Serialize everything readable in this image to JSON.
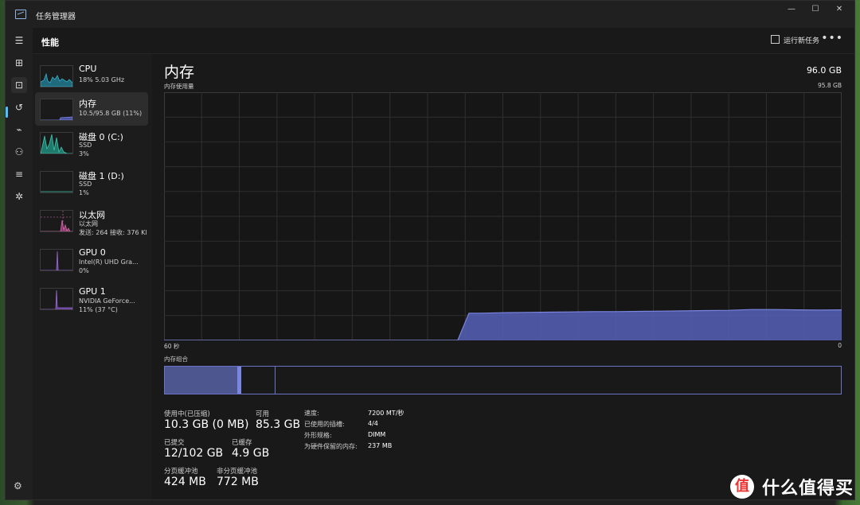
{
  "window": {
    "title": "任务管理器",
    "minimize": "—",
    "maximize": "☐",
    "close": "✕"
  },
  "nav": {
    "items": [
      {
        "icon": "hamburger-icon",
        "glyph": "☰"
      },
      {
        "icon": "processes-icon",
        "glyph": "⊞"
      },
      {
        "icon": "performance-icon",
        "glyph": "⊡"
      },
      {
        "icon": "history-icon",
        "glyph": "↺"
      },
      {
        "icon": "startup-icon",
        "glyph": "⌁"
      },
      {
        "icon": "users-icon",
        "glyph": "⚇"
      },
      {
        "icon": "details-icon",
        "glyph": "≡"
      },
      {
        "icon": "services-icon",
        "glyph": "✲"
      }
    ],
    "settings_glyph": "⚙"
  },
  "header": {
    "title": "性能",
    "run_task": "运行新任务",
    "more": "•••"
  },
  "sidebar": {
    "items": [
      {
        "name": "CPU",
        "sub1": "18% 5.03 GHz",
        "sub2": "",
        "color": "#36b0c8"
      },
      {
        "name": "内存",
        "sub1": "10.5/95.8 GB (11%)",
        "sub2": "",
        "color": "#7b86e0"
      },
      {
        "name": "磁盘 0 (C:)",
        "sub1": "SSD",
        "sub2": "3%",
        "color": "#3fc4b0"
      },
      {
        "name": "磁盘 1 (D:)",
        "sub1": "SSD",
        "sub2": "1%",
        "color": "#3fc4b0"
      },
      {
        "name": "以太网",
        "sub1": "以太网",
        "sub2": "发送: 264 接收: 376 Kl",
        "color": "#d46aa8"
      },
      {
        "name": "GPU 0",
        "sub1": "Intel(R) UHD Gra...",
        "sub2": "0%",
        "color": "#9b6ad4"
      },
      {
        "name": "GPU 1",
        "sub1": "NVIDIA GeForce...",
        "sub2": "11% (37 °C)",
        "color": "#9b6ad4"
      }
    ]
  },
  "main": {
    "title": "内存",
    "total": "96.0 GB",
    "graph_label": "内存使用量",
    "graph_max": "95.8 GB",
    "axis_left": "60 秒",
    "axis_right": "0",
    "composition_label": "内存组合",
    "composition": {
      "in_use": 10.3,
      "modified": 0.5,
      "standby": 4.9,
      "free": 80.1
    },
    "stats": [
      {
        "label": "使用中(已压缩)",
        "value": "10.3 GB (0 MB)"
      },
      {
        "label": "可用",
        "value": "85.3 GB"
      },
      {
        "label": "已提交",
        "value": "12/102 GB"
      },
      {
        "label": "已缓存",
        "value": "4.9 GB"
      },
      {
        "label": "分页缓冲池",
        "value": "424 MB"
      },
      {
        "label": "非分页缓冲池",
        "value": "772 MB"
      }
    ],
    "details": [
      {
        "label": "速度:",
        "value": "7200 MT/秒"
      },
      {
        "label": "已使用的插槽:",
        "value": "4/4"
      },
      {
        "label": "外形规格:",
        "value": "DIMM"
      },
      {
        "label": "为硬件保留的内存:",
        "value": "237 MB"
      }
    ]
  },
  "colors": {
    "accent": "#4cc2ff",
    "memory": "#7b86e0",
    "memory_fill": "#5560b8",
    "grid": "#2f2f2f"
  },
  "chart_data": {
    "type": "area",
    "title": "",
    "xlabel": "",
    "ylabel": "",
    "xlim": [
      60,
      0
    ],
    "ylim": [
      0,
      95.8
    ],
    "x": [
      60,
      34,
      33,
      32,
      30,
      28,
      26,
      24,
      22,
      20,
      18,
      16,
      14,
      12,
      10,
      8,
      6,
      4,
      2,
      0
    ],
    "values": [
      0,
      0,
      10.5,
      10.5,
      10.7,
      10.8,
      10.9,
      11.0,
      11.1,
      11.1,
      11.2,
      11.3,
      11.4,
      11.5,
      11.6,
      11.9,
      11.9,
      11.8,
      11.7,
      11.8
    ]
  },
  "watermark": {
    "logo": "值",
    "text": "什么值得买"
  }
}
